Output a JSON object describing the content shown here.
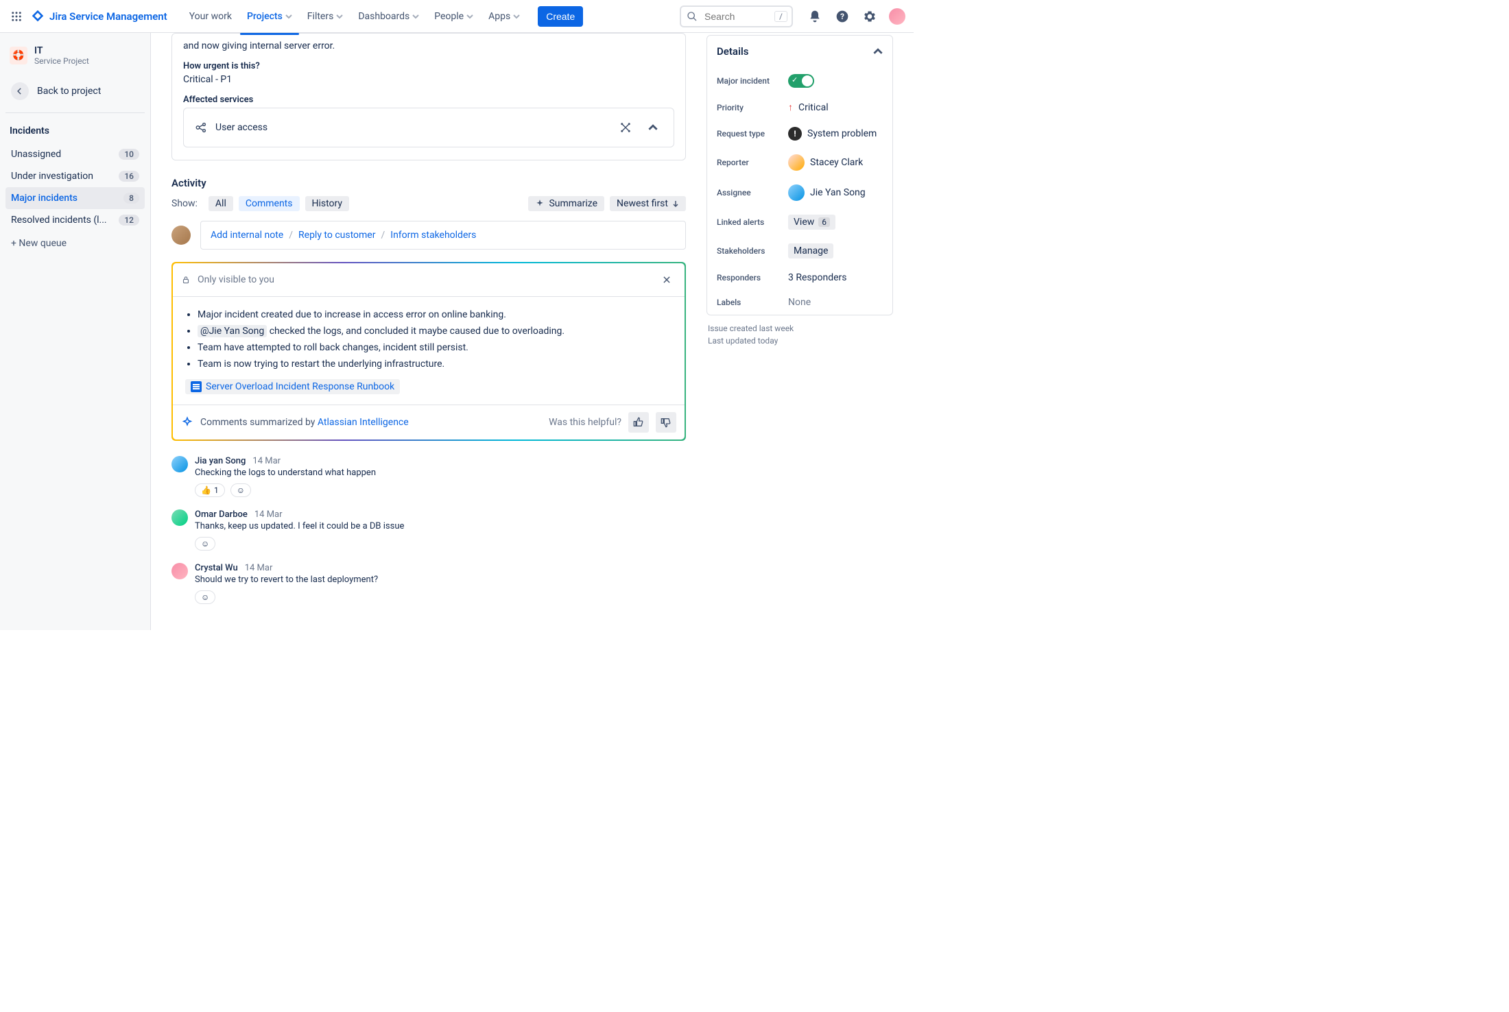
{
  "nav": {
    "app_name": "Jira Service Management",
    "links": [
      "Your work",
      "Projects",
      "Filters",
      "Dashboards",
      "People",
      "Apps"
    ],
    "active_index": 1,
    "create": "Create",
    "search_placeholder": "Search",
    "kbd": "/"
  },
  "sidebar": {
    "project_name": "IT",
    "project_type": "Service Project",
    "back": "Back to project",
    "heading": "Incidents",
    "queues": [
      {
        "label": "Unassigned",
        "count": "10"
      },
      {
        "label": "Under investigation",
        "count": "16"
      },
      {
        "label": "Major incidents",
        "count": "8"
      },
      {
        "label": "Resolved incidents (l...",
        "count": "12"
      }
    ],
    "selected_index": 2,
    "new_queue": "+ New queue"
  },
  "desc": {
    "text": "and now giving internal server error.",
    "urgency_h": "How urgent is this?",
    "urgency_v": "Critical - P1",
    "services_h": "Affected services",
    "service": "User access"
  },
  "activity": {
    "heading": "Activity",
    "show": "Show:",
    "filters": [
      "All",
      "Comments",
      "History"
    ],
    "selected_filter": 1,
    "summarize": "Summarize",
    "sort": "Newest first",
    "compose": {
      "note": "Add internal note",
      "reply": "Reply to customer",
      "inform": "Inform stakeholders"
    }
  },
  "ai": {
    "visibility": "Only visible to you",
    "bullets": [
      "Major incident created due to increase in access error on online banking.",
      {
        "mention": "@Jie Yan Song",
        "rest": " checked the logs, and concluded it maybe caused due to overloading."
      },
      "Team have attempted to roll back changes, incident still persist.",
      "Team is now trying to restart the underlying infrastructure."
    ],
    "runbook": "Server Overload Incident Response Runbook",
    "footer_prefix": "Comments summarized by ",
    "footer_link": "Atlassian Intelligence",
    "helpful": "Was this helpful?"
  },
  "comments": [
    {
      "author": "Jia yan Song",
      "date": "14 Mar",
      "text": "Checking the logs to understand what happen",
      "reaction": "👍",
      "reaction_count": "1"
    },
    {
      "author": "Omar Darboe",
      "date": "14 Mar",
      "text": "Thanks, keep us updated. I feel it could be a DB issue"
    },
    {
      "author": "Crystal Wu",
      "date": "14 Mar",
      "text": "Should we try to revert to the last deployment?"
    }
  ],
  "details": {
    "heading": "Details",
    "fields": {
      "major_incident": {
        "label": "Major incident",
        "on": true
      },
      "priority": {
        "label": "Priority",
        "value": "Critical"
      },
      "request_type": {
        "label": "Request type",
        "value": "System problem"
      },
      "reporter": {
        "label": "Reporter",
        "value": "Stacey Clark"
      },
      "assignee": {
        "label": "Assignee",
        "value": "Jie Yan Song"
      },
      "linked_alerts": {
        "label": "Linked alerts",
        "chip": "View",
        "count": "6"
      },
      "stakeholders": {
        "label": "Stakeholders",
        "chip": "Manage"
      },
      "responders": {
        "label": "Responders",
        "value": "3 Responders"
      },
      "labels": {
        "label": "Labels",
        "value": "None"
      }
    },
    "created": "Issue created last week",
    "updated": "Last updated today"
  }
}
